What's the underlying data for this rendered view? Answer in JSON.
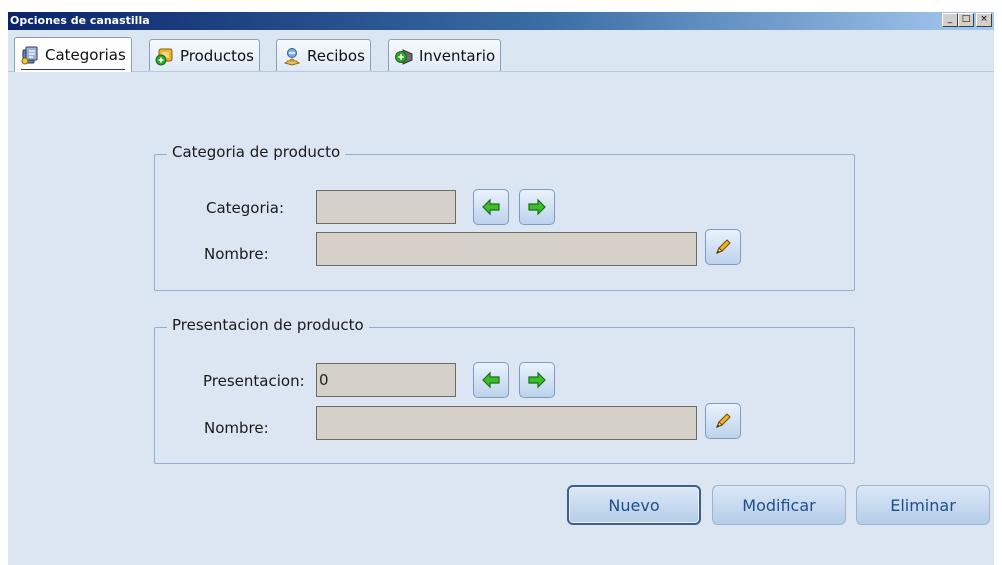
{
  "window": {
    "title": "Opciones de canastilla",
    "controls": {
      "minimize": "_",
      "maximize": "□",
      "close": "×"
    }
  },
  "tabs": [
    {
      "label": "Categorias",
      "icon": "category-icon",
      "active": true
    },
    {
      "label": "Productos",
      "icon": "products-icon",
      "active": false
    },
    {
      "label": "Recibos",
      "icon": "receipts-icon",
      "active": false
    },
    {
      "label": "Inventario",
      "icon": "inventory-icon",
      "active": false
    }
  ],
  "categoria_group": {
    "title": "Categoria de producto",
    "categoria_label": "Categoria:",
    "categoria_value": "",
    "nombre_label": "Nombre:",
    "nombre_value": ""
  },
  "presentacion_group": {
    "title": "Presentacion de producto",
    "presentacion_label": "Presentacion:",
    "presentacion_value": "0",
    "nombre_label": "Nombre:",
    "nombre_value": ""
  },
  "actions": {
    "nuevo": "Nuevo",
    "modificar": "Modificar",
    "eliminar": "Eliminar"
  },
  "colors": {
    "titlebar_start": "#0a246a",
    "panel_bg": "#dce6f2",
    "field_bg": "#d6d1c8",
    "arrow_green": "#3cbf2a",
    "action_text": "#1f4e8c"
  }
}
